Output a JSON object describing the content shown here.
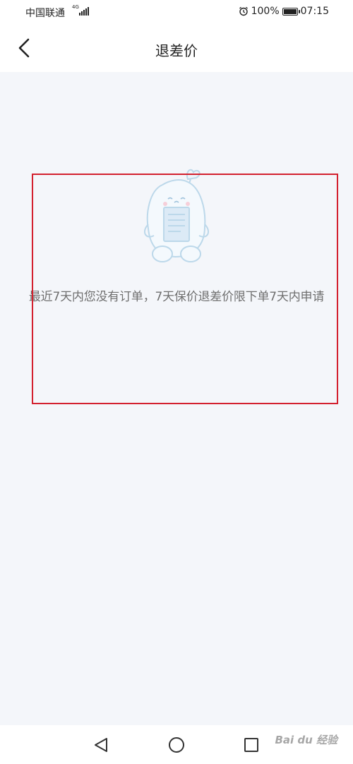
{
  "status_bar": {
    "carrier": "中国联通",
    "network": "4G",
    "battery": "100%",
    "battery_level": 1.0,
    "time": "07:15"
  },
  "header": {
    "title": "退差价",
    "back_icon": "chevron-left-icon"
  },
  "empty_state": {
    "illustration": "mascot-holding-document",
    "message": "最近7天内您没有订单，7天保价退差价限下单7天内申请"
  },
  "system_nav": {
    "back_icon": "triangle-back-icon",
    "home_icon": "circle-home-icon",
    "recents_icon": "square-recents-icon"
  },
  "watermark": {
    "text": "Bai du 经验"
  },
  "colors": {
    "background": "#f4f6fa",
    "highlight": "#d3202e",
    "illustration": "#bcd8ea"
  }
}
